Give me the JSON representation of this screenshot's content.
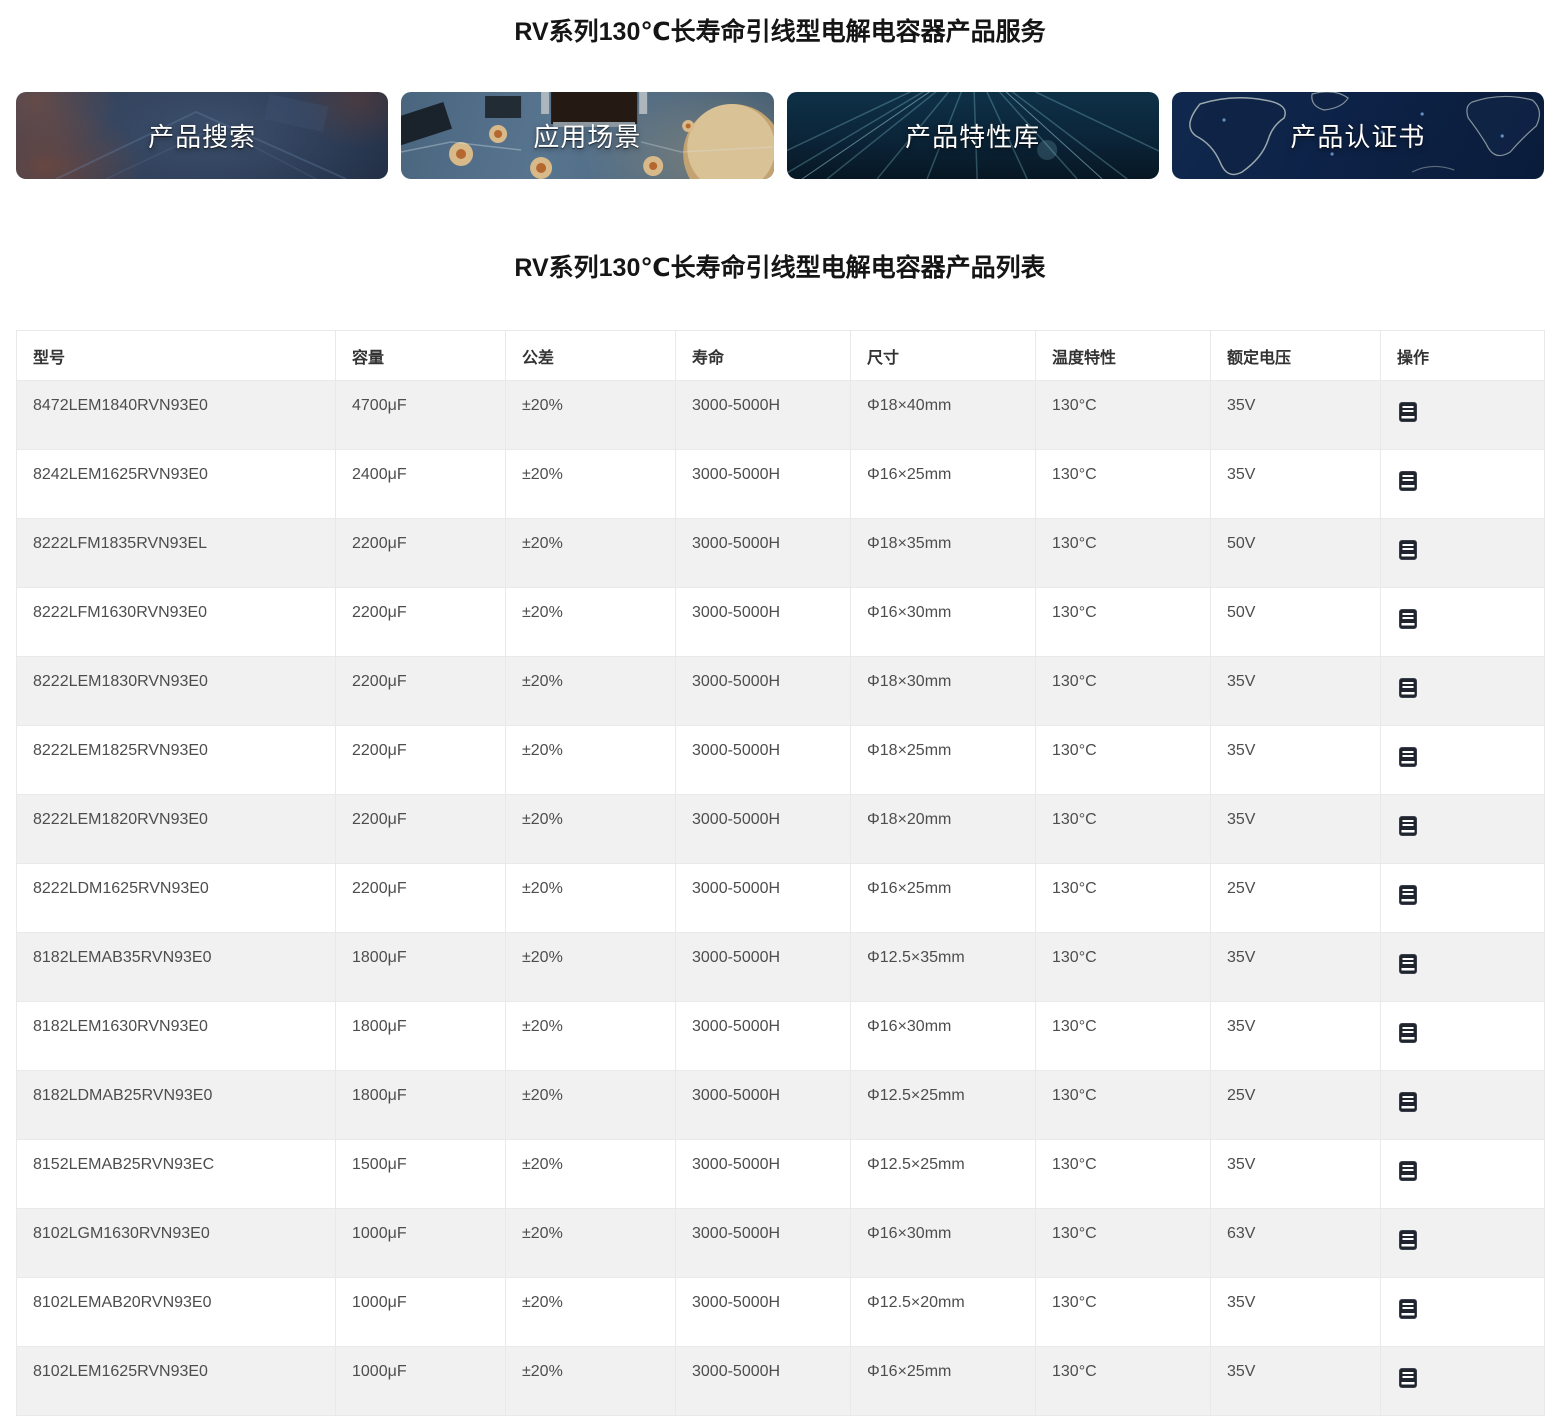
{
  "page": {
    "service_title": "RV系列130℃长寿命引线型电解电容器产品服务",
    "list_title": "RV系列130℃长寿命引线型电解电容器产品列表"
  },
  "cards": [
    {
      "label": "产品搜索"
    },
    {
      "label": "应用场景"
    },
    {
      "label": "产品特性库"
    },
    {
      "label": "产品认证书"
    }
  ],
  "table": {
    "headers": [
      "型号",
      "容量",
      "公差",
      "寿命",
      "尺寸",
      "温度特性",
      "额定电压",
      "操作"
    ],
    "keys": [
      "model",
      "capacity",
      "tolerance",
      "life",
      "size",
      "temp",
      "voltage"
    ],
    "rows": [
      {
        "model": "8472LEM1840RVN93E0",
        "capacity": "4700μF",
        "tolerance": "±20%",
        "life": "3000-5000H",
        "size": "Φ18×40mm",
        "temp": "130°C",
        "voltage": "35V"
      },
      {
        "model": "8242LEM1625RVN93E0",
        "capacity": "2400μF",
        "tolerance": "±20%",
        "life": "3000-5000H",
        "size": "Φ16×25mm",
        "temp": "130°C",
        "voltage": "35V"
      },
      {
        "model": "8222LFM1835RVN93EL",
        "capacity": "2200μF",
        "tolerance": "±20%",
        "life": "3000-5000H",
        "size": "Φ18×35mm",
        "temp": "130°C",
        "voltage": "50V"
      },
      {
        "model": "8222LFM1630RVN93E0",
        "capacity": "2200μF",
        "tolerance": "±20%",
        "life": "3000-5000H",
        "size": "Φ16×30mm",
        "temp": "130°C",
        "voltage": "50V"
      },
      {
        "model": "8222LEM1830RVN93E0",
        "capacity": "2200μF",
        "tolerance": "±20%",
        "life": "3000-5000H",
        "size": "Φ18×30mm",
        "temp": "130°C",
        "voltage": "35V"
      },
      {
        "model": "8222LEM1825RVN93E0",
        "capacity": "2200μF",
        "tolerance": "±20%",
        "life": "3000-5000H",
        "size": "Φ18×25mm",
        "temp": "130°C",
        "voltage": "35V"
      },
      {
        "model": "8222LEM1820RVN93E0",
        "capacity": "2200μF",
        "tolerance": "±20%",
        "life": "3000-5000H",
        "size": "Φ18×20mm",
        "temp": "130°C",
        "voltage": "35V"
      },
      {
        "model": "8222LDM1625RVN93E0",
        "capacity": "2200μF",
        "tolerance": "±20%",
        "life": "3000-5000H",
        "size": "Φ16×25mm",
        "temp": "130°C",
        "voltage": "25V"
      },
      {
        "model": "8182LEMAB35RVN93E0",
        "capacity": "1800μF",
        "tolerance": "±20%",
        "life": "3000-5000H",
        "size": "Φ12.5×35mm",
        "temp": "130°C",
        "voltage": "35V"
      },
      {
        "model": "8182LEM1630RVN93E0",
        "capacity": "1800μF",
        "tolerance": "±20%",
        "life": "3000-5000H",
        "size": "Φ16×30mm",
        "temp": "130°C",
        "voltage": "35V"
      },
      {
        "model": "8182LDMAB25RVN93E0",
        "capacity": "1800μF",
        "tolerance": "±20%",
        "life": "3000-5000H",
        "size": "Φ12.5×25mm",
        "temp": "130°C",
        "voltage": "25V"
      },
      {
        "model": "8152LEMAB25RVN93EC",
        "capacity": "1500μF",
        "tolerance": "±20%",
        "life": "3000-5000H",
        "size": "Φ12.5×25mm",
        "temp": "130°C",
        "voltage": "35V"
      },
      {
        "model": "8102LGM1630RVN93E0",
        "capacity": "1000μF",
        "tolerance": "±20%",
        "life": "3000-5000H",
        "size": "Φ16×30mm",
        "temp": "130°C",
        "voltage": "63V"
      },
      {
        "model": "8102LEMAB20RVN93E0",
        "capacity": "1000μF",
        "tolerance": "±20%",
        "life": "3000-5000H",
        "size": "Φ12.5×20mm",
        "temp": "130°C",
        "voltage": "35V"
      },
      {
        "model": "8102LEM1625RVN93E0",
        "capacity": "1000μF",
        "tolerance": "±20%",
        "life": "3000-5000H",
        "size": "Φ16×25mm",
        "temp": "130°C",
        "voltage": "35V"
      }
    ]
  },
  "colors": {
    "stripe": "#f1f1f1",
    "border": "#e9e9e9",
    "icon_bg": "#20242e",
    "card_navy": "#0d2247"
  }
}
